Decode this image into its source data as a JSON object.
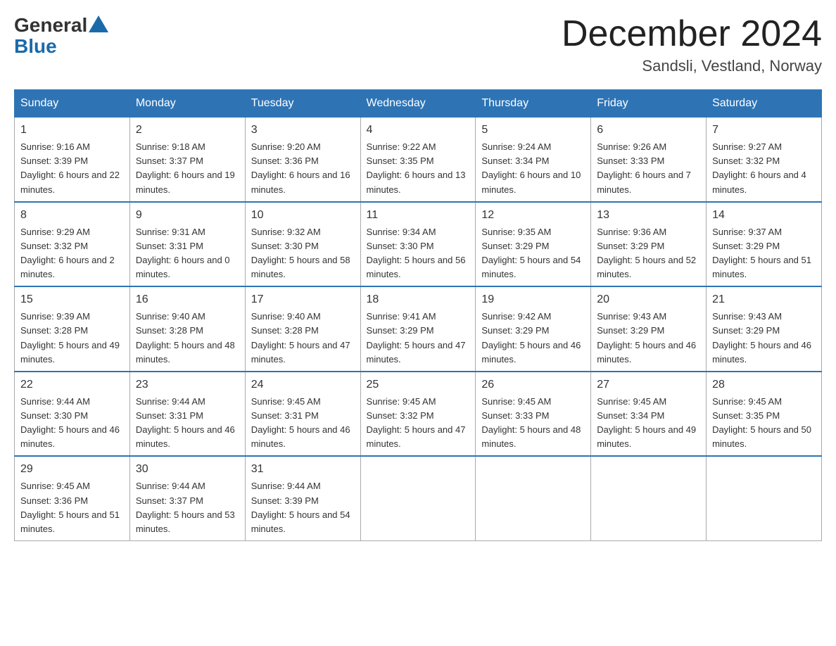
{
  "logo": {
    "general": "General",
    "blue": "Blue"
  },
  "title": "December 2024",
  "location": "Sandsli, Vestland, Norway",
  "days": [
    "Sunday",
    "Monday",
    "Tuesday",
    "Wednesday",
    "Thursday",
    "Friday",
    "Saturday"
  ],
  "weeks": [
    [
      {
        "date": "1",
        "sunrise": "9:16 AM",
        "sunset": "3:39 PM",
        "daylight": "6 hours and 22 minutes."
      },
      {
        "date": "2",
        "sunrise": "9:18 AM",
        "sunset": "3:37 PM",
        "daylight": "6 hours and 19 minutes."
      },
      {
        "date": "3",
        "sunrise": "9:20 AM",
        "sunset": "3:36 PM",
        "daylight": "6 hours and 16 minutes."
      },
      {
        "date": "4",
        "sunrise": "9:22 AM",
        "sunset": "3:35 PM",
        "daylight": "6 hours and 13 minutes."
      },
      {
        "date": "5",
        "sunrise": "9:24 AM",
        "sunset": "3:34 PM",
        "daylight": "6 hours and 10 minutes."
      },
      {
        "date": "6",
        "sunrise": "9:26 AM",
        "sunset": "3:33 PM",
        "daylight": "6 hours and 7 minutes."
      },
      {
        "date": "7",
        "sunrise": "9:27 AM",
        "sunset": "3:32 PM",
        "daylight": "6 hours and 4 minutes."
      }
    ],
    [
      {
        "date": "8",
        "sunrise": "9:29 AM",
        "sunset": "3:32 PM",
        "daylight": "6 hours and 2 minutes."
      },
      {
        "date": "9",
        "sunrise": "9:31 AM",
        "sunset": "3:31 PM",
        "daylight": "6 hours and 0 minutes."
      },
      {
        "date": "10",
        "sunrise": "9:32 AM",
        "sunset": "3:30 PM",
        "daylight": "5 hours and 58 minutes."
      },
      {
        "date": "11",
        "sunrise": "9:34 AM",
        "sunset": "3:30 PM",
        "daylight": "5 hours and 56 minutes."
      },
      {
        "date": "12",
        "sunrise": "9:35 AM",
        "sunset": "3:29 PM",
        "daylight": "5 hours and 54 minutes."
      },
      {
        "date": "13",
        "sunrise": "9:36 AM",
        "sunset": "3:29 PM",
        "daylight": "5 hours and 52 minutes."
      },
      {
        "date": "14",
        "sunrise": "9:37 AM",
        "sunset": "3:29 PM",
        "daylight": "5 hours and 51 minutes."
      }
    ],
    [
      {
        "date": "15",
        "sunrise": "9:39 AM",
        "sunset": "3:28 PM",
        "daylight": "5 hours and 49 minutes."
      },
      {
        "date": "16",
        "sunrise": "9:40 AM",
        "sunset": "3:28 PM",
        "daylight": "5 hours and 48 minutes."
      },
      {
        "date": "17",
        "sunrise": "9:40 AM",
        "sunset": "3:28 PM",
        "daylight": "5 hours and 47 minutes."
      },
      {
        "date": "18",
        "sunrise": "9:41 AM",
        "sunset": "3:29 PM",
        "daylight": "5 hours and 47 minutes."
      },
      {
        "date": "19",
        "sunrise": "9:42 AM",
        "sunset": "3:29 PM",
        "daylight": "5 hours and 46 minutes."
      },
      {
        "date": "20",
        "sunrise": "9:43 AM",
        "sunset": "3:29 PM",
        "daylight": "5 hours and 46 minutes."
      },
      {
        "date": "21",
        "sunrise": "9:43 AM",
        "sunset": "3:29 PM",
        "daylight": "5 hours and 46 minutes."
      }
    ],
    [
      {
        "date": "22",
        "sunrise": "9:44 AM",
        "sunset": "3:30 PM",
        "daylight": "5 hours and 46 minutes."
      },
      {
        "date": "23",
        "sunrise": "9:44 AM",
        "sunset": "3:31 PM",
        "daylight": "5 hours and 46 minutes."
      },
      {
        "date": "24",
        "sunrise": "9:45 AM",
        "sunset": "3:31 PM",
        "daylight": "5 hours and 46 minutes."
      },
      {
        "date": "25",
        "sunrise": "9:45 AM",
        "sunset": "3:32 PM",
        "daylight": "5 hours and 47 minutes."
      },
      {
        "date": "26",
        "sunrise": "9:45 AM",
        "sunset": "3:33 PM",
        "daylight": "5 hours and 48 minutes."
      },
      {
        "date": "27",
        "sunrise": "9:45 AM",
        "sunset": "3:34 PM",
        "daylight": "5 hours and 49 minutes."
      },
      {
        "date": "28",
        "sunrise": "9:45 AM",
        "sunset": "3:35 PM",
        "daylight": "5 hours and 50 minutes."
      }
    ],
    [
      {
        "date": "29",
        "sunrise": "9:45 AM",
        "sunset": "3:36 PM",
        "daylight": "5 hours and 51 minutes."
      },
      {
        "date": "30",
        "sunrise": "9:44 AM",
        "sunset": "3:37 PM",
        "daylight": "5 hours and 53 minutes."
      },
      {
        "date": "31",
        "sunrise": "9:44 AM",
        "sunset": "3:39 PM",
        "daylight": "5 hours and 54 minutes."
      },
      null,
      null,
      null,
      null
    ]
  ]
}
